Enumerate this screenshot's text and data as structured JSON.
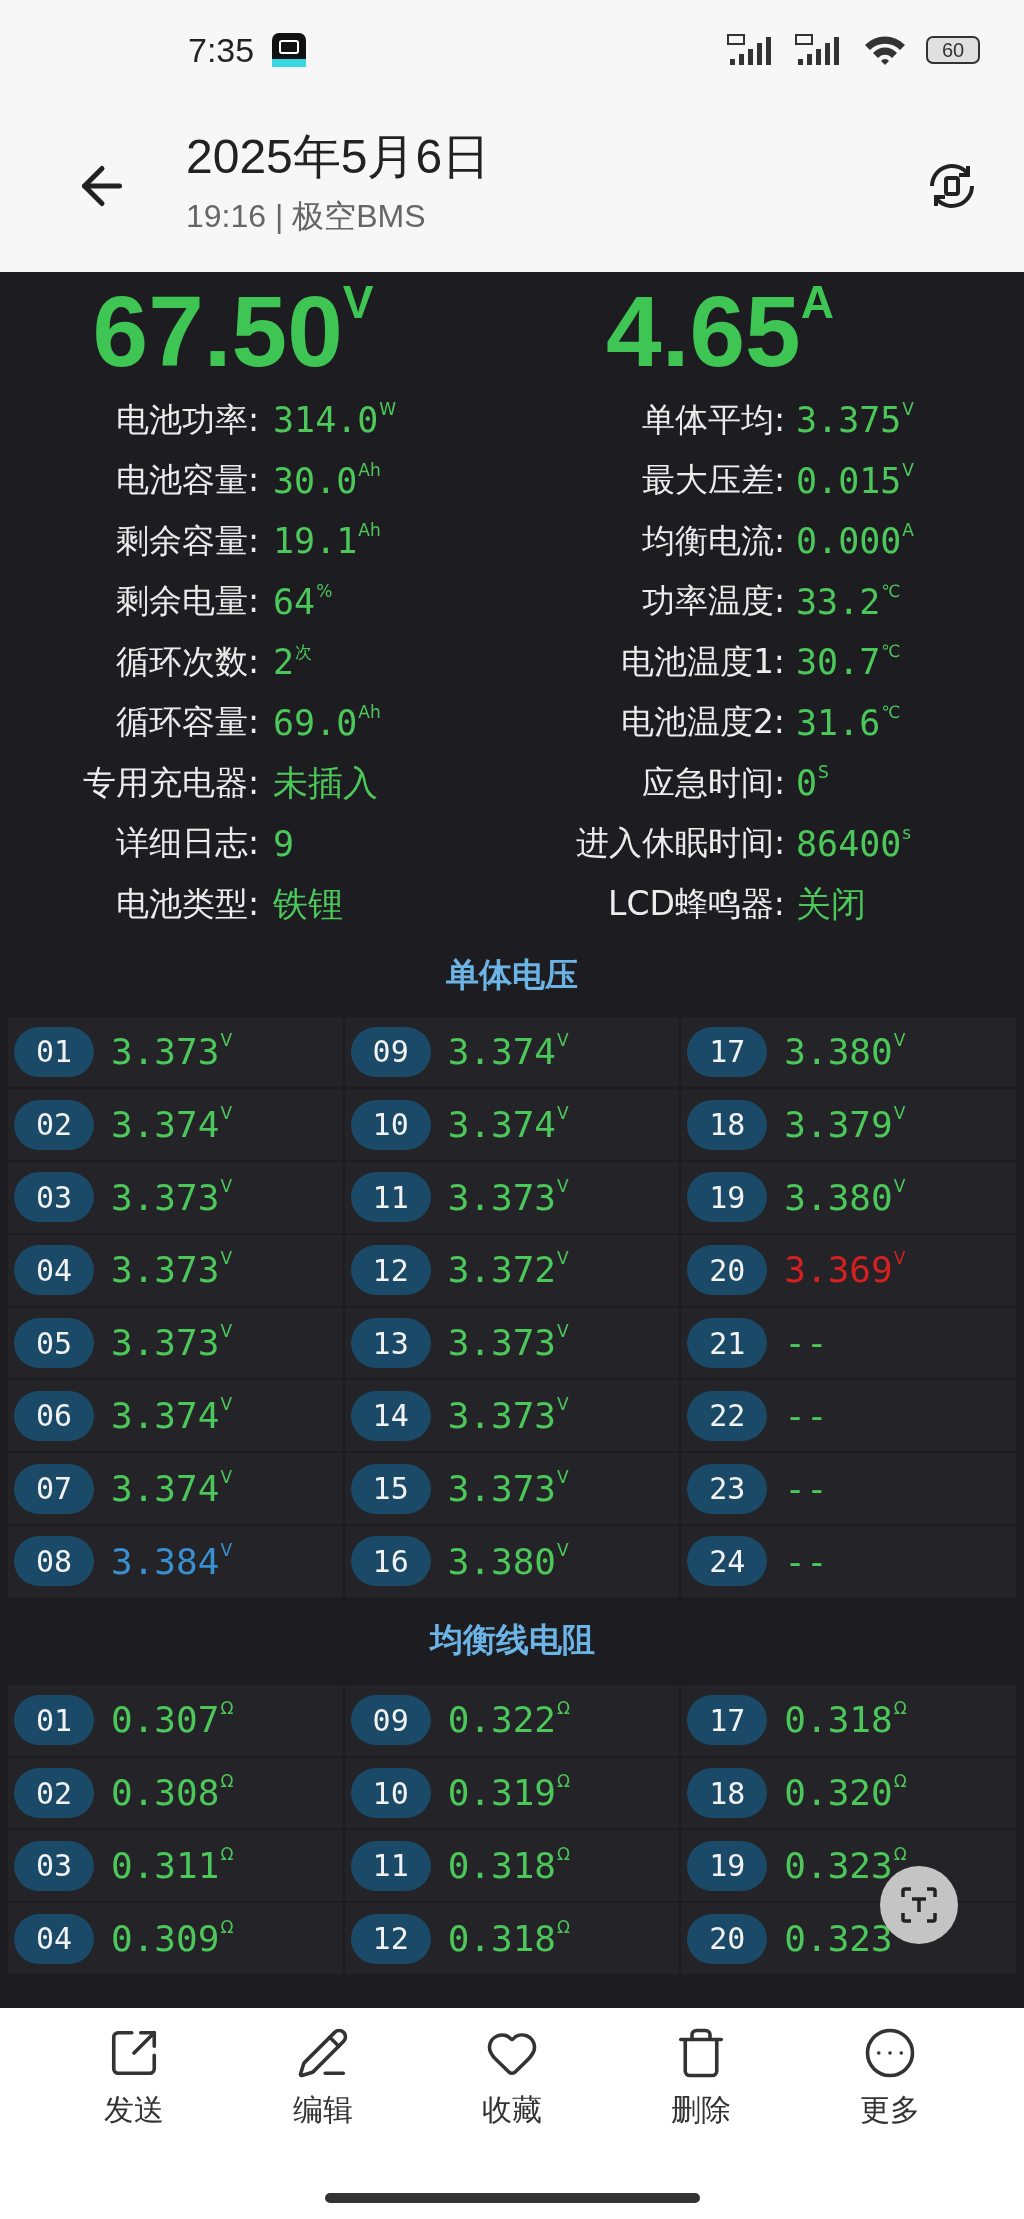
{
  "status_bar": {
    "time": "7:35",
    "battery": "60"
  },
  "header": {
    "title": "2025年5月6日",
    "subtitle": "19:16 | 极空BMS"
  },
  "readings": [
    {
      "value": "67.50",
      "unit": "V"
    },
    {
      "value": "4.65",
      "unit": "A"
    }
  ],
  "stats_left": [
    {
      "label": "电池功率:",
      "value": "314.0",
      "unit": "W"
    },
    {
      "label": "电池容量:",
      "value": "30.0",
      "unit": "Ah"
    },
    {
      "label": "剩余容量:",
      "value": "19.1",
      "unit": "Ah"
    },
    {
      "label": "剩余电量:",
      "value": "64",
      "unit": "%"
    },
    {
      "label": "循环次数:",
      "value": "2",
      "unit": "次"
    },
    {
      "label": "循环容量:",
      "value": "69.0",
      "unit": "Ah"
    },
    {
      "label": "专用充电器:",
      "value": "未插入"
    },
    {
      "label": "详细日志:",
      "value": "9"
    },
    {
      "label": "电池类型:",
      "value": "铁锂"
    }
  ],
  "stats_right": [
    {
      "label": "单体平均:",
      "value": "3.375",
      "unit": "V"
    },
    {
      "label": "最大压差:",
      "value": "0.015",
      "unit": "V"
    },
    {
      "label": "均衡电流:",
      "value": "0.000",
      "unit": "A"
    },
    {
      "label": "功率温度:",
      "value": "33.2",
      "unit": "℃"
    },
    {
      "label": "电池温度1:",
      "value": "30.7",
      "unit": "℃"
    },
    {
      "label": "电池温度2:",
      "value": "31.6",
      "unit": "℃"
    },
    {
      "label": "应急时间:",
      "value": "0",
      "unit": "S"
    },
    {
      "label": "进入休眠时间:",
      "value": "86400",
      "unit": "s"
    },
    {
      "label": "LCD蜂鸣器:",
      "value": "关闭"
    }
  ],
  "cell_voltage": {
    "title": "单体电压",
    "cells": [
      {
        "index": "01",
        "value": "3.373",
        "unit": "V",
        "color": "#4cc75a"
      },
      {
        "index": "02",
        "value": "3.374",
        "unit": "V",
        "color": "#4cc75a"
      },
      {
        "index": "03",
        "value": "3.373",
        "unit": "V",
        "color": "#4cc75a"
      },
      {
        "index": "04",
        "value": "3.373",
        "unit": "V",
        "color": "#4cc75a"
      },
      {
        "index": "05",
        "value": "3.373",
        "unit": "V",
        "color": "#4cc75a"
      },
      {
        "index": "06",
        "value": "3.374",
        "unit": "V",
        "color": "#4cc75a"
      },
      {
        "index": "07",
        "value": "3.374",
        "unit": "V",
        "color": "#4cc75a"
      },
      {
        "index": "08",
        "value": "3.384",
        "unit": "V",
        "color": "#3a8fd0"
      },
      {
        "index": "09",
        "value": "3.374",
        "unit": "V",
        "color": "#4cc75a"
      },
      {
        "index": "10",
        "value": "3.374",
        "unit": "V",
        "color": "#4cc75a"
      },
      {
        "index": "11",
        "value": "3.373",
        "unit": "V",
        "color": "#4cc75a"
      },
      {
        "index": "12",
        "value": "3.372",
        "unit": "V",
        "color": "#4cc75a"
      },
      {
        "index": "13",
        "value": "3.373",
        "unit": "V",
        "color": "#4cc75a"
      },
      {
        "index": "14",
        "value": "3.373",
        "unit": "V",
        "color": "#4cc75a"
      },
      {
        "index": "15",
        "value": "3.373",
        "unit": "V",
        "color": "#4cc75a"
      },
      {
        "index": "16",
        "value": "3.380",
        "unit": "V",
        "color": "#4cc75a"
      },
      {
        "index": "17",
        "value": "3.380",
        "unit": "V",
        "color": "#4cc75a"
      },
      {
        "index": "18",
        "value": "3.379",
        "unit": "V",
        "color": "#4cc75a"
      },
      {
        "index": "19",
        "value": "3.380",
        "unit": "V",
        "color": "#4cc75a"
      },
      {
        "index": "20",
        "value": "3.369",
        "unit": "V",
        "color": "#d42020"
      },
      {
        "index": "21",
        "value": "--",
        "color": "#4cc75a"
      },
      {
        "index": "22",
        "value": "--",
        "color": "#4cc75a"
      },
      {
        "index": "23",
        "value": "--",
        "color": "#4cc75a"
      },
      {
        "index": "24",
        "value": "--",
        "color": "#4cc75a"
      }
    ]
  },
  "balance_resistance": {
    "title": "均衡线电阻",
    "cells": [
      {
        "index": "01",
        "value": "0.307",
        "unit": "Ω"
      },
      {
        "index": "02",
        "value": "0.308",
        "unit": "Ω"
      },
      {
        "index": "03",
        "value": "0.311",
        "unit": "Ω"
      },
      {
        "index": "04",
        "value": "0.309",
        "unit": "Ω"
      },
      {
        "index": "09",
        "value": "0.322",
        "unit": "Ω"
      },
      {
        "index": "10",
        "value": "0.319",
        "unit": "Ω"
      },
      {
        "index": "11",
        "value": "0.318",
        "unit": "Ω"
      },
      {
        "index": "12",
        "value": "0.318",
        "unit": "Ω"
      },
      {
        "index": "17",
        "value": "0.318",
        "unit": "Ω"
      },
      {
        "index": "18",
        "value": "0.320",
        "unit": "Ω"
      },
      {
        "index": "19",
        "value": "0.323",
        "unit": "Ω"
      },
      {
        "index": "20",
        "value": "0.323"
      }
    ]
  },
  "toolbar": [
    "发送",
    "编辑",
    "收藏",
    "删除",
    "更多"
  ]
}
